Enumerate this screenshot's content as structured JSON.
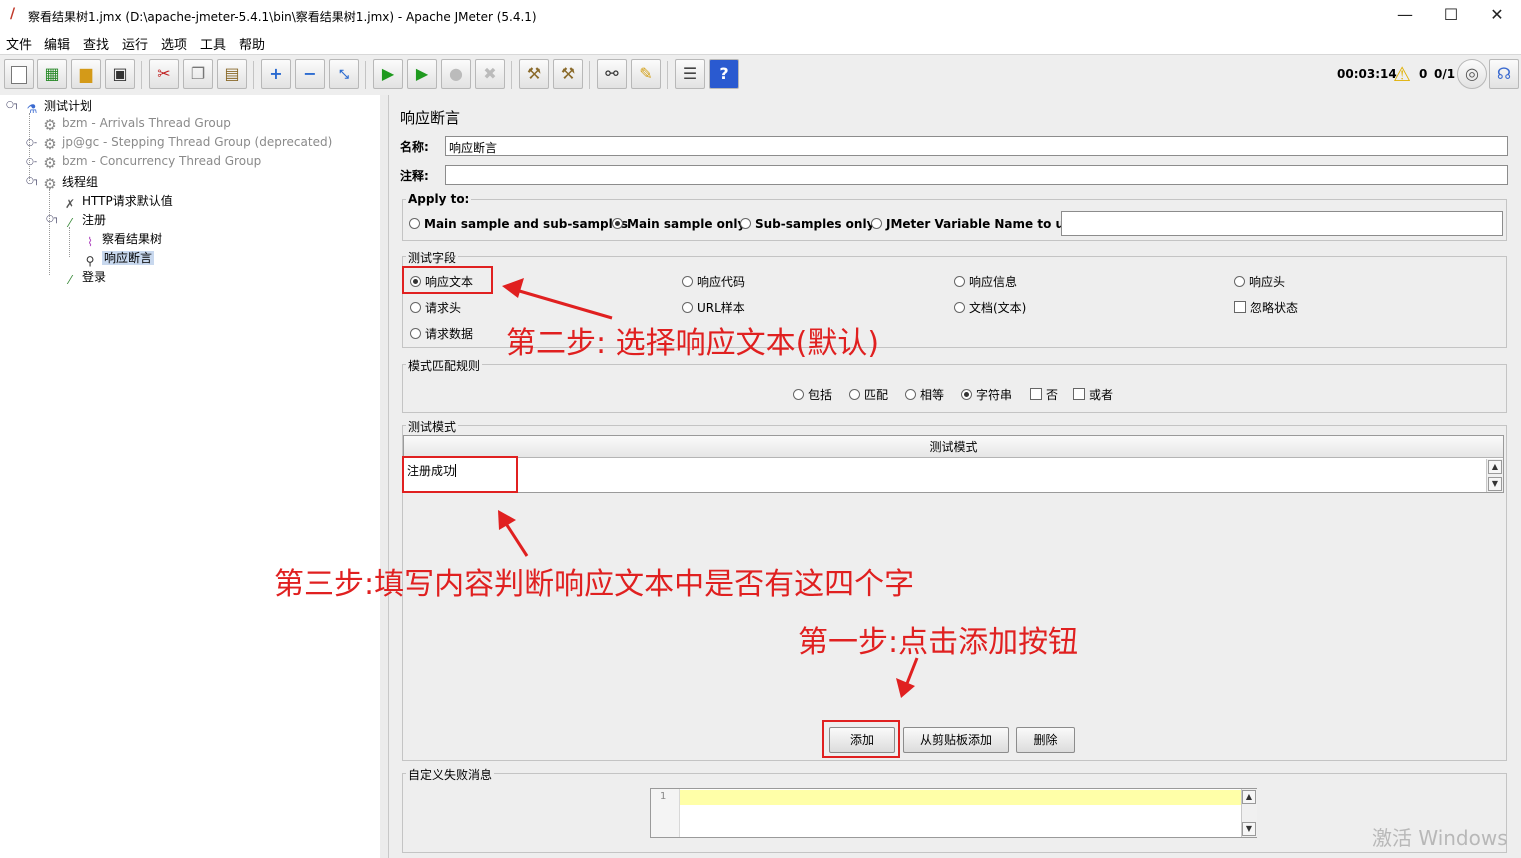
{
  "window": {
    "title": "察看结果树1.jmx (D:\\apache-jmeter-5.4.1\\bin\\察看结果树1.jmx) - Apache JMeter (5.4.1)",
    "minimize": "—",
    "maximize": "☐",
    "close": "✕"
  },
  "menu": [
    "文件",
    "编辑",
    "查找",
    "运行",
    "选项",
    "工具",
    "帮助"
  ],
  "toolbar": {
    "timer": "00:03:14",
    "warnings": "0",
    "threads": "0/1",
    "icons": [
      "new-icon",
      "templates-icon",
      "open-icon",
      "save-icon",
      "cut-icon",
      "copy-icon",
      "paste-icon",
      "expand-icon",
      "collapse-icon",
      "toggle-icon",
      "start-icon",
      "start-no-pause-icon",
      "stop-icon",
      "shutdown-icon",
      "clear-icon",
      "clear-all-icon",
      "search-icon",
      "reset-search-icon",
      "function-helper-icon",
      "help-icon"
    ]
  },
  "tree": {
    "items": [
      {
        "label": "测试计划",
        "icon": "test-plan-icon",
        "disabled": false
      },
      {
        "label": "bzm - Arrivals Thread Group",
        "icon": "gear-icon",
        "disabled": true
      },
      {
        "label": "jp@gc - Stepping Thread Group (deprecated)",
        "icon": "gear-icon",
        "disabled": true
      },
      {
        "label": "bzm - Concurrency Thread Group",
        "icon": "gear-icon",
        "disabled": true
      },
      {
        "label": "线程组",
        "icon": "gear-icon",
        "disabled": false
      },
      {
        "label": "HTTP请求默认值",
        "icon": "wrench-icon",
        "disabled": false
      },
      {
        "label": "注册",
        "icon": "pipette-icon",
        "disabled": false
      },
      {
        "label": "察看结果树",
        "icon": "chart-icon",
        "disabled": false
      },
      {
        "label": "响应断言",
        "icon": "magnifier-icon",
        "disabled": false,
        "selected": true
      },
      {
        "label": "登录",
        "icon": "pipette-icon",
        "disabled": false
      }
    ]
  },
  "panel": {
    "heading": "响应断言",
    "name_label": "名称:",
    "name_value": "响应断言",
    "comment_label": "注释:",
    "comment_value": "",
    "apply_to": {
      "title": "Apply to:",
      "options": [
        "Main sample and sub-samples",
        "Main sample only",
        "Sub-samples only",
        "JMeter Variable Name to use"
      ],
      "selected": "Main sample only",
      "variable_value": ""
    },
    "field_to_test": {
      "title": "测试字段",
      "options": [
        "响应文本",
        "响应代码",
        "响应信息",
        "响应头",
        "请求头",
        "URL样本",
        "文档(文本)",
        "忽略状态",
        "请求数据"
      ],
      "selected": "响应文本",
      "ignore_status_checked": false
    },
    "matching_rules": {
      "title": "模式匹配规则",
      "options": [
        "包括",
        "匹配",
        "相等",
        "字符串",
        "否",
        "或者"
      ],
      "selected": "字符串",
      "not_checked": false,
      "or_checked": false
    },
    "patterns": {
      "title": "测试模式",
      "column_header": "测试模式",
      "rows": [
        "注册成功"
      ]
    },
    "buttons": {
      "add": "添加",
      "add_from_clipboard": "从剪贴板添加",
      "delete": "删除"
    },
    "failure_message": {
      "title": "自定义失败消息",
      "line_number": "1",
      "value": ""
    }
  },
  "annotations": {
    "step1": "第一步:点击添加按钮",
    "step2": "第二步: 选择响应文本(默认)",
    "step3": "第三步:填写内容判断响应文本中是否有这四个字",
    "color": "#e02020"
  },
  "watermark": "激活 Windows"
}
